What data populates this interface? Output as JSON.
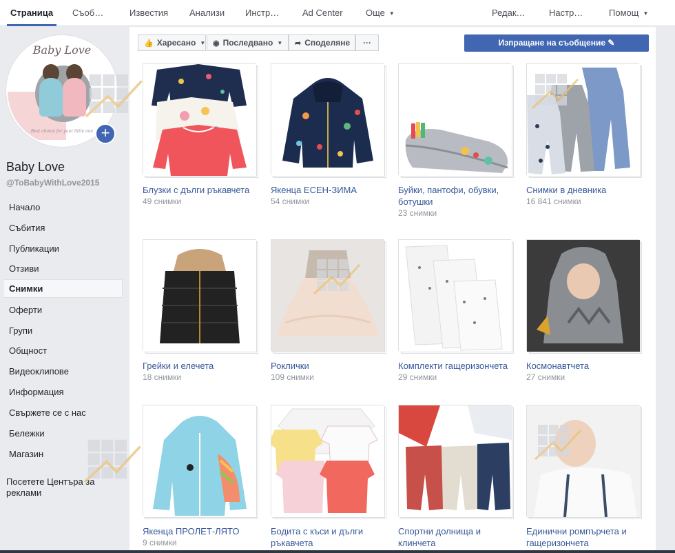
{
  "topnav": {
    "items": [
      {
        "label": "Страница",
        "active": true
      },
      {
        "label": "Съоб…"
      },
      {
        "label": "Известия"
      },
      {
        "label": "Анализи"
      },
      {
        "label": "Инстр…"
      },
      {
        "label": "Ad Center"
      },
      {
        "label": "Още"
      },
      {
        "label": "Редак…"
      },
      {
        "label": "Настр…"
      },
      {
        "label": "Помощ"
      }
    ]
  },
  "sidebar": {
    "page_name": "Baby Love",
    "page_handle": "@ToBabyWithLove2015",
    "logo_text": "Baby Love",
    "logo_tagline": "Best choice for your little one",
    "items": [
      {
        "label": "Начало"
      },
      {
        "label": "Събития"
      },
      {
        "label": "Публикации"
      },
      {
        "label": "Отзиви"
      },
      {
        "label": "Снимки",
        "active": true
      },
      {
        "label": "Оферти"
      },
      {
        "label": "Групи"
      },
      {
        "label": "Общност"
      },
      {
        "label": "Видеоклипове"
      },
      {
        "label": "Информация"
      },
      {
        "label": "Свържете се с нас"
      },
      {
        "label": "Бележки"
      },
      {
        "label": "Магазин"
      }
    ],
    "promo": "Посетете Центъра за реклами"
  },
  "actionbar": {
    "like": "Харесано",
    "follow": "Последвано",
    "share": "Споделяне",
    "more": "···",
    "send": "Изпращане на съобщение"
  },
  "albums": [
    {
      "title": "Блузки с дълги ръкавчета",
      "count": "49 снимки"
    },
    {
      "title": "Якенца ЕСЕН-ЗИМА",
      "count": "54 снимки"
    },
    {
      "title": "Буйки, пантофи, обувки, ботушки",
      "count": "23 снимки"
    },
    {
      "title": "Снимки в дневника",
      "count": "16 841 снимки"
    },
    {
      "title": "Грейки и елечета",
      "count": "18 снимки"
    },
    {
      "title": "Роклички",
      "count": "109 снимки"
    },
    {
      "title": "Комплекти гащеризончета",
      "count": "29 снимки"
    },
    {
      "title": "Космонавтчета",
      "count": "27 снимки"
    },
    {
      "title": "Якенца ПРОЛЕТ-ЛЯТО",
      "count": "9 снимки"
    },
    {
      "title": "Бодита с къси и дълги ръкавчета",
      "count": ""
    },
    {
      "title": "Спортни долнища и клинчета",
      "count": ""
    },
    {
      "title": "Единични ромпърчета и гащеризончета",
      "count": ""
    }
  ],
  "colors": {
    "facebook_blue": "#4267b2",
    "link_blue": "#365899",
    "muted_gray": "#90949c",
    "background": "#e9ebee"
  }
}
